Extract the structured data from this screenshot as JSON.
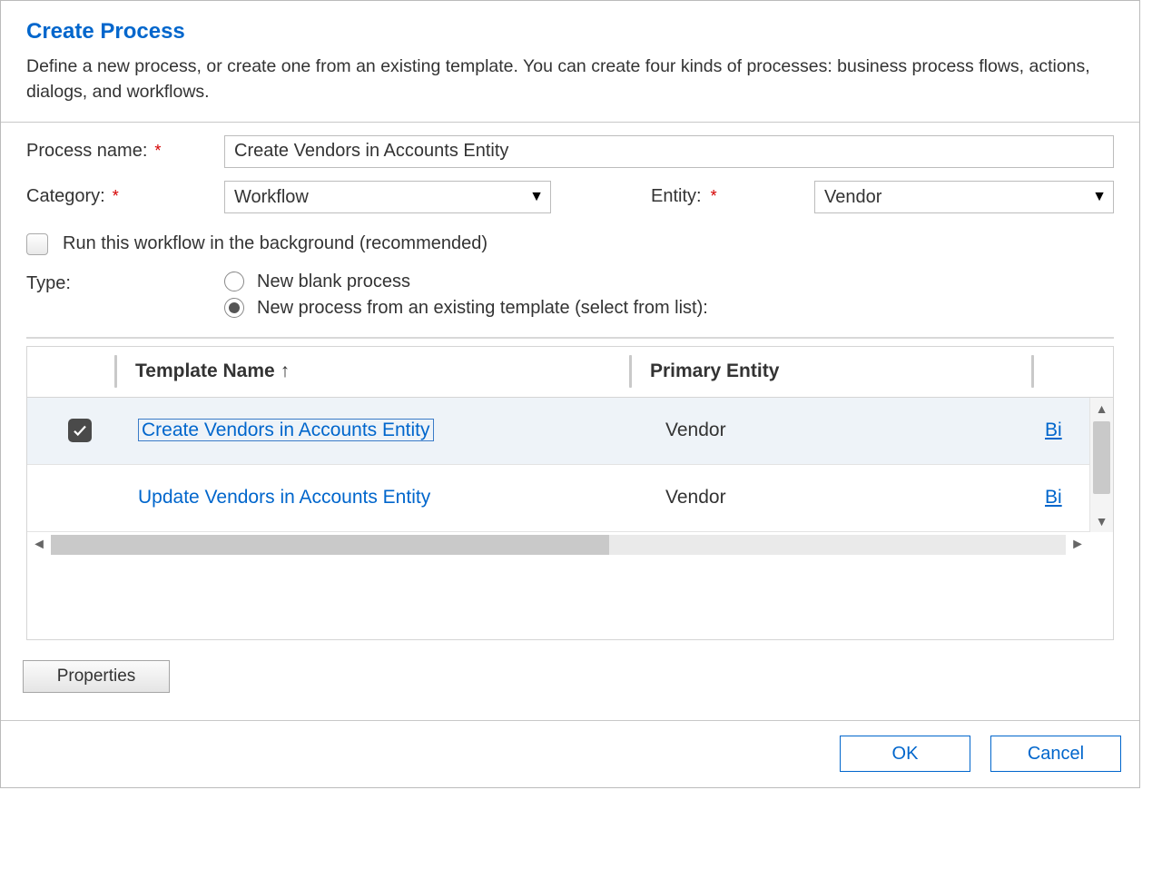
{
  "header": {
    "title": "Create Process",
    "subtitle": "Define a new process, or create one from an existing template. You can create four kinds of processes: business process flows, actions, dialogs, and workflows."
  },
  "form": {
    "processNameLabel": "Process name:",
    "processNameValue": "Create Vendors in Accounts Entity",
    "categoryLabel": "Category:",
    "categoryValue": "Workflow",
    "entityLabel": "Entity:",
    "entityValue": "Vendor",
    "backgroundLabel": "Run this workflow in the background (recommended)",
    "typeLabel": "Type:",
    "typeBlank": "New blank process",
    "typeTemplate": "New process from an existing template (select from list):"
  },
  "table": {
    "colTemplateName": "Template Name",
    "sortIndicator": "↑",
    "colPrimaryEntity": "Primary Entity",
    "rows": [
      {
        "name": "Create Vendors in Accounts Entity",
        "entity": "Vendor",
        "owner": "Bi",
        "selected": true
      },
      {
        "name": "Update Vendors in Accounts Entity",
        "entity": "Vendor",
        "owner": "Bi",
        "selected": false
      }
    ]
  },
  "buttons": {
    "properties": "Properties",
    "ok": "OK",
    "cancel": "Cancel"
  }
}
